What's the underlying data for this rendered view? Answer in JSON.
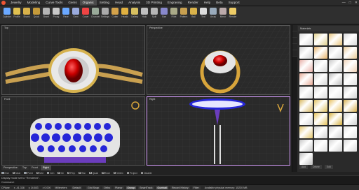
{
  "menu": {
    "items": [
      "Jewelry",
      "Modeling",
      "Curve Tools",
      "Gems",
      "Organic",
      "Setting",
      "Head",
      "Analysis",
      "3D Printing",
      "Engraving",
      "Render",
      "Help",
      "Beta",
      "Support"
    ],
    "active_index": 4
  },
  "toolbar": {
    "tools": [
      {
        "label": "Cylinder",
        "icon": "cylinder-icon",
        "color": "#6aa8ff"
      },
      {
        "label": "Profile",
        "icon": "profile-icon",
        "color": "#e0c050"
      },
      {
        "label": "Shank",
        "icon": "shank-icon",
        "color": "#d9b24a"
      },
      {
        "label": "Quick",
        "icon": "quick-icon",
        "color": "#c59a3a"
      },
      {
        "label": "Bezel",
        "icon": "bezel-icon",
        "color": "#b4b4b4"
      },
      {
        "label": "Prong",
        "icon": "prong-icon",
        "color": "#c8c8c8"
      },
      {
        "label": "Pave",
        "icon": "pave-icon",
        "color": "#6aa8ff"
      },
      {
        "label": "Gem",
        "icon": "gem-icon",
        "color": "#9ad"
      },
      {
        "label": "Curve",
        "icon": "curve-icon",
        "color": "#e44"
      },
      {
        "label": "Channel",
        "icon": "channel-icon",
        "color": "#9a9"
      },
      {
        "label": "Settings",
        "icon": "setting-icon",
        "color": "#aaa"
      },
      {
        "label": "Cutter",
        "icon": "cutter-icon",
        "color": "#d4a24a"
      },
      {
        "label": "Heads",
        "icon": "heads-icon",
        "color": "#e0b040"
      },
      {
        "label": "Gallery",
        "icon": "gallery-icon",
        "color": "#d8c060"
      },
      {
        "label": "Halo",
        "icon": "halo-icon",
        "color": "#c0c0c0"
      },
      {
        "label": "Split",
        "icon": "split-icon",
        "color": "#b6b6b6"
      },
      {
        "label": "Size",
        "icon": "size-icon",
        "color": "#88c"
      },
      {
        "label": "Fillet",
        "icon": "fillet-icon",
        "color": "#aa8"
      },
      {
        "label": "Pattern",
        "icon": "pattern-icon",
        "color": "#c8a050"
      },
      {
        "label": "Bail",
        "icon": "bail-icon",
        "color": "#d9b24a"
      },
      {
        "label": "Text",
        "icon": "text-icon",
        "color": "#ddd"
      },
      {
        "label": "Array",
        "icon": "array-icon",
        "color": "#9ab"
      },
      {
        "label": "Mirror",
        "icon": "mirror-icon",
        "color": "#baa"
      },
      {
        "label": "Render",
        "icon": "render-icon",
        "color": "#ec6"
      }
    ]
  },
  "viewports": {
    "top": {
      "title": "Top"
    },
    "perspective": {
      "title": "Perspective"
    },
    "front": {
      "title": "Front"
    },
    "right": {
      "title": "Right"
    }
  },
  "viewport_tabs": [
    "Perspective",
    "Top",
    "Front",
    "Right"
  ],
  "viewport_tabs_active": 3,
  "osnaps": [
    {
      "label": "End",
      "on": true
    },
    {
      "label": "Near",
      "on": false
    },
    {
      "label": "Point",
      "on": true
    },
    {
      "label": "Mid",
      "on": false
    },
    {
      "label": "Cen",
      "on": true
    },
    {
      "label": "Int",
      "on": false
    },
    {
      "label": "Perp",
      "on": false
    },
    {
      "label": "Tan",
      "on": false
    },
    {
      "label": "Quad",
      "on": false
    },
    {
      "label": "Knot",
      "on": false
    },
    {
      "label": "Vertex",
      "on": false
    },
    {
      "label": "Project",
      "on": false
    },
    {
      "label": "Disable",
      "on": false
    }
  ],
  "command": {
    "history": "Display mode set to \"Rendered\".",
    "prompt": "Command:"
  },
  "status": {
    "cplane": "CPlane",
    "x": "x -41.338",
    "y": "y 14.653",
    "z": "z 0.000",
    "units": "Millimeters",
    "layer": "Default",
    "buttons": [
      {
        "label": "Grid Snap",
        "on": false
      },
      {
        "label": "Ortho",
        "on": false
      },
      {
        "label": "Planar",
        "on": false
      },
      {
        "label": "Osnap",
        "on": true
      },
      {
        "label": "SmartTrack",
        "on": false
      },
      {
        "label": "Gumball",
        "on": true
      },
      {
        "label": "Record History",
        "on": false
      },
      {
        "label": "Filter",
        "on": false
      }
    ],
    "memory": "Available physical memory: 15230 MB"
  },
  "materials": {
    "header": "Materials",
    "swatches": [
      "#d9d9d9",
      "#e0cf8a",
      "#e8c47a",
      "#d8d8d8",
      "#cfcfcf",
      "#e6b26a",
      "#d7d7d7",
      "#e9c995",
      "#e8b0a8",
      "#d9d9d9",
      "#c8c8c8",
      "#efd3b8",
      "#e6a995",
      "#d6d6d6",
      "#bcbcbc",
      "#e0e0e0",
      "#d9d9d9",
      "#dcdcdc",
      "#e8e8e8",
      "#d2d2d2",
      "#d8b860",
      "#e0c060",
      "#e8c060",
      "#d8b050",
      "#d9d9d9",
      "#e6c35a",
      "#d6b040",
      "#d0d0d0",
      "#e3c56a",
      "#d2d2d2",
      "#cfcfcf",
      "#e5e5e5",
      "#c7c7c7",
      "#e1e1e1",
      "#d3d3d3",
      "#dadada",
      "#bdbdbd"
    ],
    "footer": [
      "Add",
      "Delete",
      "Edit"
    ]
  },
  "colors": {
    "gold": "#d8a53b",
    "ruby": "#d01818",
    "diamond": "#eeeeee",
    "blue_gem": "#2626d8",
    "grid": "#3a3a3a",
    "grid_dark": "#303030"
  }
}
